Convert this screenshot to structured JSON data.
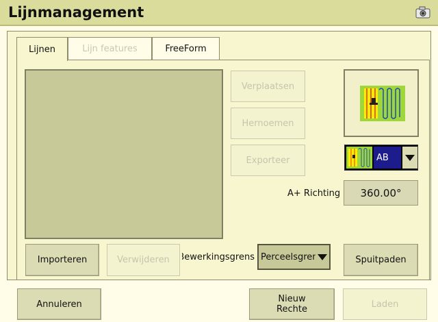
{
  "window": {
    "title": "Lijnmanagement",
    "title_icon": "camera-icon"
  },
  "tabs": [
    {
      "label": "Lijnen",
      "active": true,
      "enabled": true
    },
    {
      "label": "Lijn features",
      "active": false,
      "enabled": false
    },
    {
      "label": "FreeForm",
      "active": false,
      "enabled": true
    }
  ],
  "line_list": {
    "items": []
  },
  "actions": {
    "move": "Verplaatsen",
    "rename": "Hernoemen",
    "export": "Exporteer"
  },
  "preview": {
    "icon": "field-lines-preview-icon"
  },
  "line_type": {
    "selected": "AB",
    "icon": "ab-line-icon"
  },
  "direction": {
    "label": "A+ Richting",
    "value": "360.00°"
  },
  "bottom_row": {
    "import": "Importeren",
    "delete": "Verwijderen",
    "boundary_label": "Bewerkingsgrens",
    "boundary_value": "Perceelsgrens",
    "spray_paths": "Spuitpaden"
  },
  "footer": {
    "cancel": "Annuleren",
    "new_line_line1": "Nieuw",
    "new_line_line2": "Rechte",
    "load": "Laden"
  },
  "colors": {
    "titlebar": "#d9dc9b",
    "background": "#fffde7",
    "panel": "#f7f6ce",
    "button": "#dcdcb4",
    "list": "#c8c998",
    "accent_blue": "#1c1c8c"
  }
}
